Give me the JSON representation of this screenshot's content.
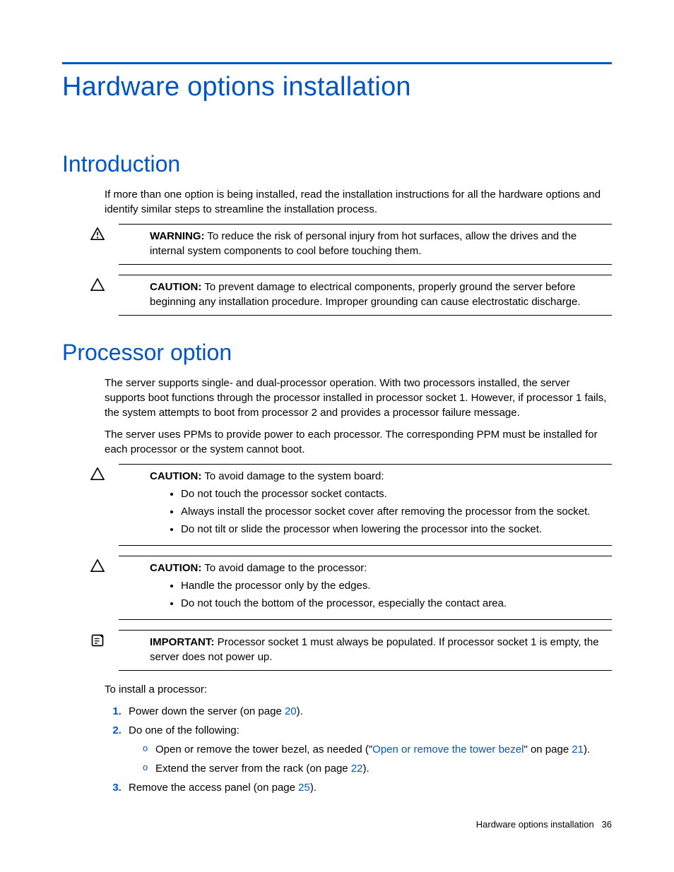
{
  "chapter_title": "Hardware options installation",
  "section_intro": {
    "title": "Introduction",
    "p1": "If more than one option is being installed, read the installation instructions for all the hardware options and identify similar steps to streamline the installation process.",
    "warning_label": "WARNING:",
    "warning_text": "To reduce the risk of personal injury from hot surfaces, allow the drives and the internal system components to cool before touching them.",
    "caution_label": "CAUTION:",
    "caution_text": "To prevent damage to electrical components, properly ground the server before beginning any installation procedure. Improper grounding can cause electrostatic discharge."
  },
  "section_proc": {
    "title": "Processor option",
    "p1": "The server supports single- and dual-processor operation. With two processors installed, the server supports boot functions through the processor installed in processor socket 1. However, if processor 1 fails, the system attempts to boot from processor 2 and provides a processor failure message.",
    "p2": "The server uses PPMs to provide power to each processor. The corresponding PPM must be installed for each processor or the system cannot boot.",
    "caution1_label": "CAUTION:",
    "caution1_text": "To avoid damage to the system board:",
    "caution1_b1": "Do not touch the processor socket contacts.",
    "caution1_b2": "Always install the processor socket cover after removing the processor from the socket.",
    "caution1_b3": "Do not tilt or slide the processor when lowering the processor into the socket.",
    "caution2_label": "CAUTION:",
    "caution2_text": "To avoid damage to the processor:",
    "caution2_b1": "Handle the processor only by the edges.",
    "caution2_b2": "Do not touch the bottom of the processor, especially the contact area.",
    "important_label": "IMPORTANT:",
    "important_text": "Processor socket 1 must always be populated. If processor socket 1 is empty, the server does not power up.",
    "lead_in": "To install a processor:",
    "step1_a": "Power down the server (on page ",
    "step1_link": "20",
    "step1_b": ").",
    "step2": "Do one of the following:",
    "step2_sub1_a": "Open or remove the tower bezel, as needed (\"",
    "step2_sub1_link": "Open or remove the tower bezel",
    "step2_sub1_b": "\" on page ",
    "step2_sub1_link2": "21",
    "step2_sub1_c": ").",
    "step2_sub2_a": "Extend the server from the rack (on page ",
    "step2_sub2_link": "22",
    "step2_sub2_b": ").",
    "step3_a": "Remove the access panel (on page ",
    "step3_link": "25",
    "step3_b": ")."
  },
  "footer": {
    "text": "Hardware options installation",
    "page": "36"
  }
}
